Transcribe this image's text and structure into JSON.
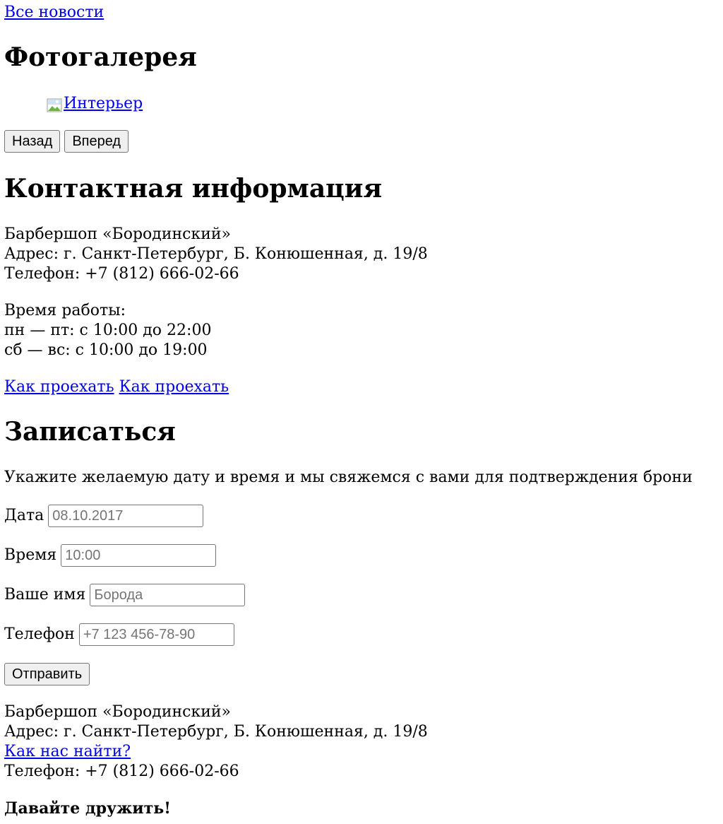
{
  "nav": {
    "all_news": "Все новости"
  },
  "gallery": {
    "title": "Фотогалерея",
    "image_alt": "Интерьер",
    "prev_button": "Назад",
    "next_button": "Вперед"
  },
  "contacts": {
    "title": "Контактная информация",
    "name": "Барбершоп «Бородинский»",
    "address": "Адрес: г. Санкт-Петербург, Б. Конюшенная, д. 19/8",
    "phone": "Телефон: +7 (812) 666-02-66",
    "hours_label": "Время работы:",
    "hours_weekdays": "пн — пт: с 10:00 до 22:00",
    "hours_weekend": "сб — вс: с 10:00 до 19:00",
    "route_link_1": "Как проехать",
    "route_link_2": "Как проехать"
  },
  "booking": {
    "title": "Записаться",
    "description": "Укажите желаемую дату и время и мы свяжемся с вами для подтверждения брони",
    "date_label": "Дата",
    "date_placeholder": "08.10.2017",
    "time_label": "Время",
    "time_placeholder": "10:00",
    "name_label": "Ваше имя",
    "name_placeholder": "Борода",
    "phone_label": "Телефон",
    "phone_placeholder": "+7 123 456-78-90",
    "submit_button": "Отправить"
  },
  "footer": {
    "name": "Барбершоп «Бородинский»",
    "address": "Адрес: г. Санкт-Петербург, Б. Конюшенная, д. 19/8",
    "find_us_link": "Как нас найти?",
    "phone": "Телефон: +7 (812) 666-02-66",
    "friends": "Давайте дружить!"
  },
  "icons": {
    "broken_image": "broken-image-icon"
  },
  "colors": {
    "link": "#0000ee",
    "text": "#000000",
    "button_bg": "#efefef",
    "border": "#767676",
    "placeholder": "#757575"
  }
}
